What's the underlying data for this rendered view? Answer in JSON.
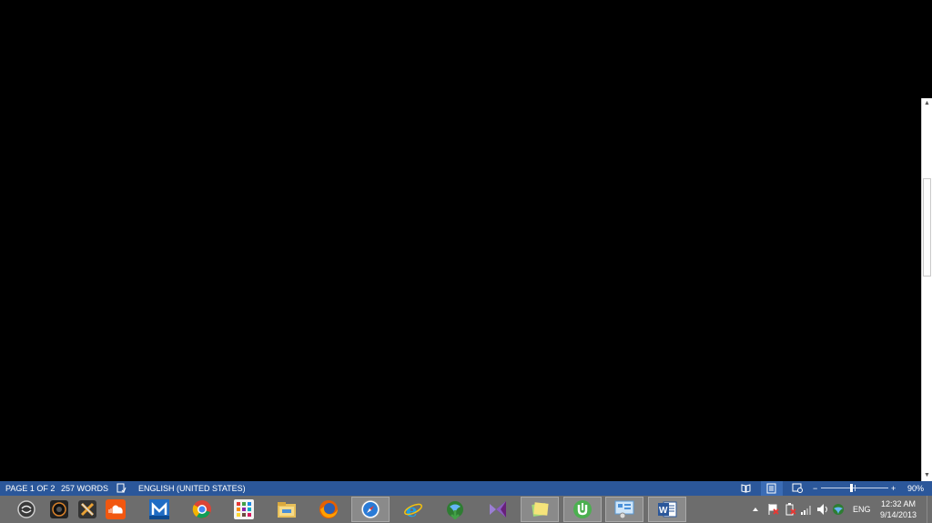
{
  "statusbar": {
    "page": "PAGE 1 OF 2",
    "words": "257 WORDS",
    "language": "ENGLISH (UNITED STATES)",
    "zoom_minus": "−",
    "zoom_plus": "+",
    "zoom": "90%"
  },
  "taskbar": {
    "apps": [
      "start-swirl-icon",
      "camera-icon",
      "tools-icon",
      "soundcloud-icon",
      "maxthon-icon",
      "chrome-icon",
      "apps-grid-icon",
      "file-explorer-icon",
      "firefox-icon",
      "safari-icon",
      "internet-explorer-icon",
      "idm-icon",
      "visual-studio-icon",
      "sticky-notes-icon",
      "utorrent-icon",
      "control-panel-icon",
      "word-icon"
    ],
    "tray": {
      "language": "ENG",
      "time": "12:32 AM",
      "date": "9/14/2013"
    }
  },
  "colors": {
    "statusbar_bg": "#2b579a",
    "taskbar_bg": "#6d6d6d",
    "document_bg": "#000000"
  }
}
